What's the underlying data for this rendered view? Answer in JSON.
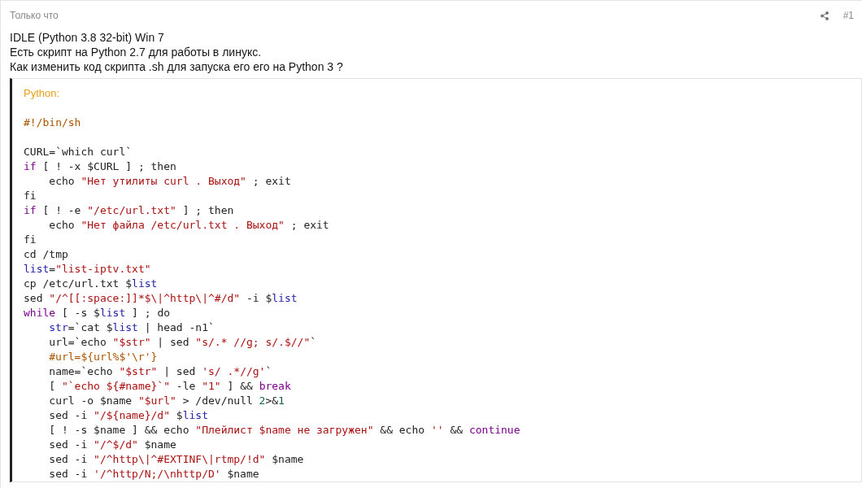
{
  "post": {
    "time": "Только что",
    "number": "#1"
  },
  "body": [
    "IDLE (Python 3.8 32-bit) Win 7",
    "Есть скрипт на Python 2.7 для работы в линукс.",
    "Как изменить код скрипта .sh для запуска его его на Python 3 ?"
  ],
  "code": {
    "language": "Python:",
    "lines": [
      {
        "tokens": [
          {
            "kind": "comment",
            "text": "#!/bin/sh"
          }
        ]
      },
      {
        "kind": "blank"
      },
      {
        "tokens": [
          {
            "kind": "plain",
            "text": "CURL=`which curl`"
          }
        ]
      },
      {
        "tokens": [
          {
            "kind": "keyword",
            "text": "if"
          },
          {
            "kind": "plain",
            "text": " [ ! -x $CURL ] ; then"
          }
        ]
      },
      {
        "tokens": [
          {
            "kind": "plain",
            "text": "    echo "
          },
          {
            "kind": "string",
            "text": "\"Нет утилиты curl . Выход\""
          },
          {
            "kind": "plain",
            "text": " ; exit"
          }
        ]
      },
      {
        "tokens": [
          {
            "kind": "plain",
            "text": "fi"
          }
        ]
      },
      {
        "tokens": [
          {
            "kind": "keyword",
            "text": "if"
          },
          {
            "kind": "plain",
            "text": " [ ! -e "
          },
          {
            "kind": "string",
            "text": "\"/etc/url.txt\""
          },
          {
            "kind": "plain",
            "text": " ] ; then"
          }
        ]
      },
      {
        "tokens": [
          {
            "kind": "plain",
            "text": "    echo "
          },
          {
            "kind": "string",
            "text": "\"Нет файла /etc/url.txt . Выход\""
          },
          {
            "kind": "plain",
            "text": " ; exit"
          }
        ]
      },
      {
        "tokens": [
          {
            "kind": "plain",
            "text": "fi"
          }
        ]
      },
      {
        "tokens": [
          {
            "kind": "plain",
            "text": "cd /tmp"
          }
        ]
      },
      {
        "tokens": [
          {
            "kind": "variable",
            "text": "list"
          },
          {
            "kind": "plain",
            "text": "="
          },
          {
            "kind": "string",
            "text": "\"list-iptv.txt\""
          }
        ]
      },
      {
        "tokens": [
          {
            "kind": "plain",
            "text": "cp /etc/url.txt $"
          },
          {
            "kind": "variable",
            "text": "list"
          }
        ]
      },
      {
        "tokens": [
          {
            "kind": "plain",
            "text": "sed "
          },
          {
            "kind": "string",
            "text": "\"/^[[:space:]]*$\\|^http\\|^#/d\""
          },
          {
            "kind": "plain",
            "text": " -i $"
          },
          {
            "kind": "variable",
            "text": "list"
          }
        ]
      },
      {
        "tokens": [
          {
            "kind": "keyword",
            "text": "while"
          },
          {
            "kind": "plain",
            "text": " [ -s $"
          },
          {
            "kind": "variable",
            "text": "list"
          },
          {
            "kind": "plain",
            "text": " ] ; do"
          }
        ]
      },
      {
        "indent": true,
        "tokens": [
          {
            "kind": "variable",
            "text": "str"
          },
          {
            "kind": "plain",
            "text": "=`cat $"
          },
          {
            "kind": "variable",
            "text": "list"
          },
          {
            "kind": "plain",
            "text": " | head -n1`"
          }
        ]
      },
      {
        "tokens": [
          {
            "kind": "plain",
            "text": "    url=`echo "
          },
          {
            "kind": "string",
            "text": "\"$str\""
          },
          {
            "kind": "plain",
            "text": " | sed "
          },
          {
            "kind": "string",
            "text": "\"s/.* //g; s/.$//\""
          },
          {
            "kind": "plain",
            "text": "`"
          }
        ]
      },
      {
        "indent": true,
        "tokens": [
          {
            "kind": "comment",
            "text": "#url=${url%$'\\r'}"
          }
        ]
      },
      {
        "tokens": [
          {
            "kind": "plain",
            "text": "    name=`echo "
          },
          {
            "kind": "string",
            "text": "\"$str\""
          },
          {
            "kind": "plain",
            "text": " | sed "
          },
          {
            "kind": "string",
            "text": "'s/ .*//g'"
          },
          {
            "kind": "plain",
            "text": "`"
          }
        ]
      },
      {
        "tokens": [
          {
            "kind": "plain",
            "text": "    [ "
          },
          {
            "kind": "string",
            "text": "\"`echo ${#name}`\""
          },
          {
            "kind": "plain",
            "text": " -le "
          },
          {
            "kind": "string",
            "text": "\"1\""
          },
          {
            "kind": "plain",
            "text": " ] && "
          },
          {
            "kind": "keyword",
            "text": "break"
          }
        ]
      },
      {
        "tokens": [
          {
            "kind": "plain",
            "text": "    curl -o $name "
          },
          {
            "kind": "string",
            "text": "\"$url\""
          },
          {
            "kind": "plain",
            "text": " > /dev/null "
          },
          {
            "kind": "number",
            "text": "2"
          },
          {
            "kind": "plain",
            "text": ">&"
          },
          {
            "kind": "number",
            "text": "1"
          }
        ]
      },
      {
        "tokens": [
          {
            "kind": "plain",
            "text": "    sed -i "
          },
          {
            "kind": "string",
            "text": "\"/${name}/d\""
          },
          {
            "kind": "plain",
            "text": " $"
          },
          {
            "kind": "variable",
            "text": "list"
          }
        ]
      },
      {
        "tokens": [
          {
            "kind": "plain",
            "text": "    [ ! -s $name ] && echo "
          },
          {
            "kind": "string",
            "text": "\"Плейлист $name не загружен\""
          },
          {
            "kind": "plain",
            "text": " && echo "
          },
          {
            "kind": "string",
            "text": "''"
          },
          {
            "kind": "plain",
            "text": " && "
          },
          {
            "kind": "keyword",
            "text": "continue"
          }
        ]
      },
      {
        "tokens": [
          {
            "kind": "plain",
            "text": "    sed -i "
          },
          {
            "kind": "string",
            "text": "\"/^$/d\""
          },
          {
            "kind": "plain",
            "text": " $name"
          }
        ]
      },
      {
        "tokens": [
          {
            "kind": "plain",
            "text": "    sed -i "
          },
          {
            "kind": "string",
            "text": "\"/^http\\|^#EXTINF\\|rtmp/!d\""
          },
          {
            "kind": "plain",
            "text": " $name"
          }
        ]
      },
      {
        "tokens": [
          {
            "kind": "plain",
            "text": "    sed -i "
          },
          {
            "kind": "string",
            "text": "'/^http/N;/\\nhttp/D'"
          },
          {
            "kind": "plain",
            "text": " $name"
          }
        ]
      }
    ]
  }
}
